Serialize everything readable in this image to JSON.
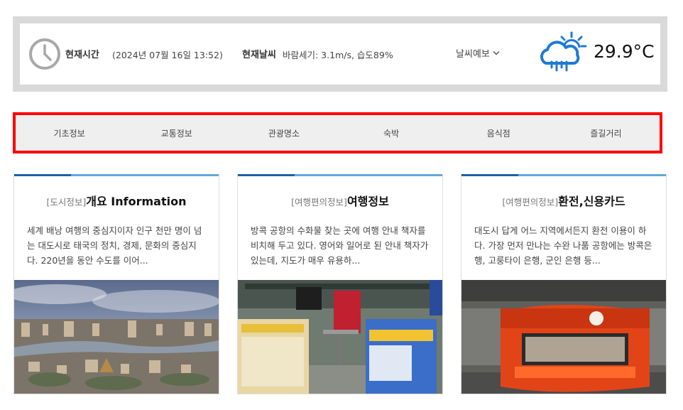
{
  "weather": {
    "time_label": "현재시간",
    "time_value": "(2024년 07월 16일 13:52)",
    "weather_label": "현재날씨",
    "weather_value": "바람세기: 3.1m/s, 습도89%",
    "forecast_label": "날씨예보",
    "temperature": "29.9°C",
    "icons": [
      "clock-icon",
      "sun-cloud-rain-icon",
      "chevron-down-icon"
    ]
  },
  "nav": {
    "items": [
      "기초정보",
      "교통정보",
      "관광명소",
      "숙박",
      "음식점",
      "즐길거리"
    ]
  },
  "cards": [
    {
      "category": "[도시정보]",
      "title": "개요 Information",
      "description": "세계 배낭 여행의 중심지이자 인구 천만 명이 넘는 대도시로 태국의 정치, 경제, 문화의 중심지다. 220년을 동안 수도를 이어..."
    },
    {
      "category": "[여행편의정보]",
      "title": "여행정보",
      "description": "방콕 공항의 수화물 찾는 곳에 여행 안내 책자를 비치해 두고 있다. 영어와 일어로 된 안내 책자가 있는데, 지도가 매우 유용하..."
    },
    {
      "category": "[여행편의정보]",
      "title": "환전,신용카드",
      "description": "대도시 답게 어느 지역에서든지 환전 이용이 하다. 가장 먼저 만나는 수완 나품 공항에는 방콕은행, 고룽타이 은행, 군인 은행 등..."
    }
  ],
  "colors": {
    "nav_border": "#ff0000",
    "card_bar_dark": "#1e5fa8",
    "card_bar_light": "#62a8de",
    "weather_icon": "#1e7ad6"
  }
}
